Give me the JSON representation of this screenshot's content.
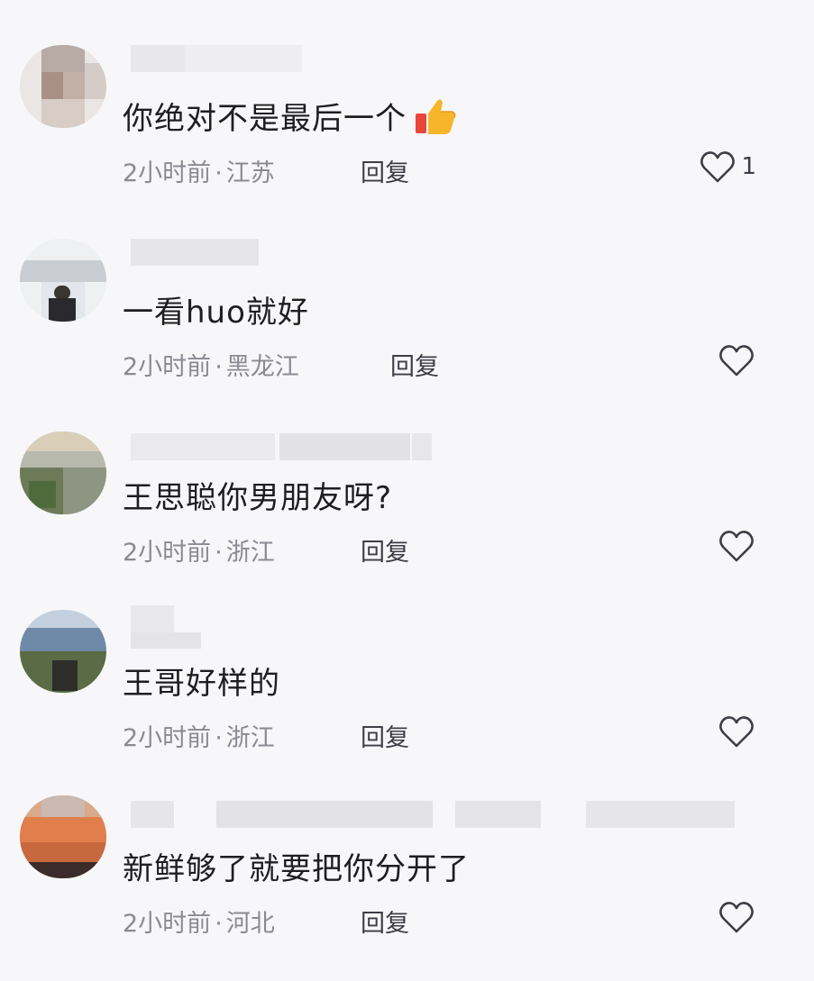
{
  "comments": [
    {
      "text": "你绝对不是最后一个",
      "has_thumbs_up": true,
      "time": "2小时前",
      "separator": "·",
      "location": "江苏",
      "reply_label": "回复",
      "like_count": "1"
    },
    {
      "text": "一看huo就好",
      "has_thumbs_up": false,
      "time": "2小时前",
      "separator": "·",
      "location": "黑龙江",
      "reply_label": "回复",
      "like_count": ""
    },
    {
      "text": "王思聪你男朋友呀?",
      "has_thumbs_up": false,
      "time": "2小时前",
      "separator": "·",
      "location": "浙江",
      "reply_label": "回复",
      "like_count": ""
    },
    {
      "text": "王哥好样的",
      "has_thumbs_up": false,
      "time": "2小时前",
      "separator": "·",
      "location": "浙江",
      "reply_label": "回复",
      "like_count": ""
    },
    {
      "text": "新鲜够了就要把你分开了",
      "has_thumbs_up": false,
      "time": "2小时前",
      "separator": "·",
      "location": "河北",
      "reply_label": "回复",
      "like_count": ""
    }
  ],
  "icons": {
    "like": "heart-outline-icon",
    "emoji": "thumbs-up-icon"
  },
  "colors": {
    "background": "#f7f7f9",
    "text": "#1d1d22",
    "meta": "#8a8a92",
    "heart": "#3d3d45"
  }
}
